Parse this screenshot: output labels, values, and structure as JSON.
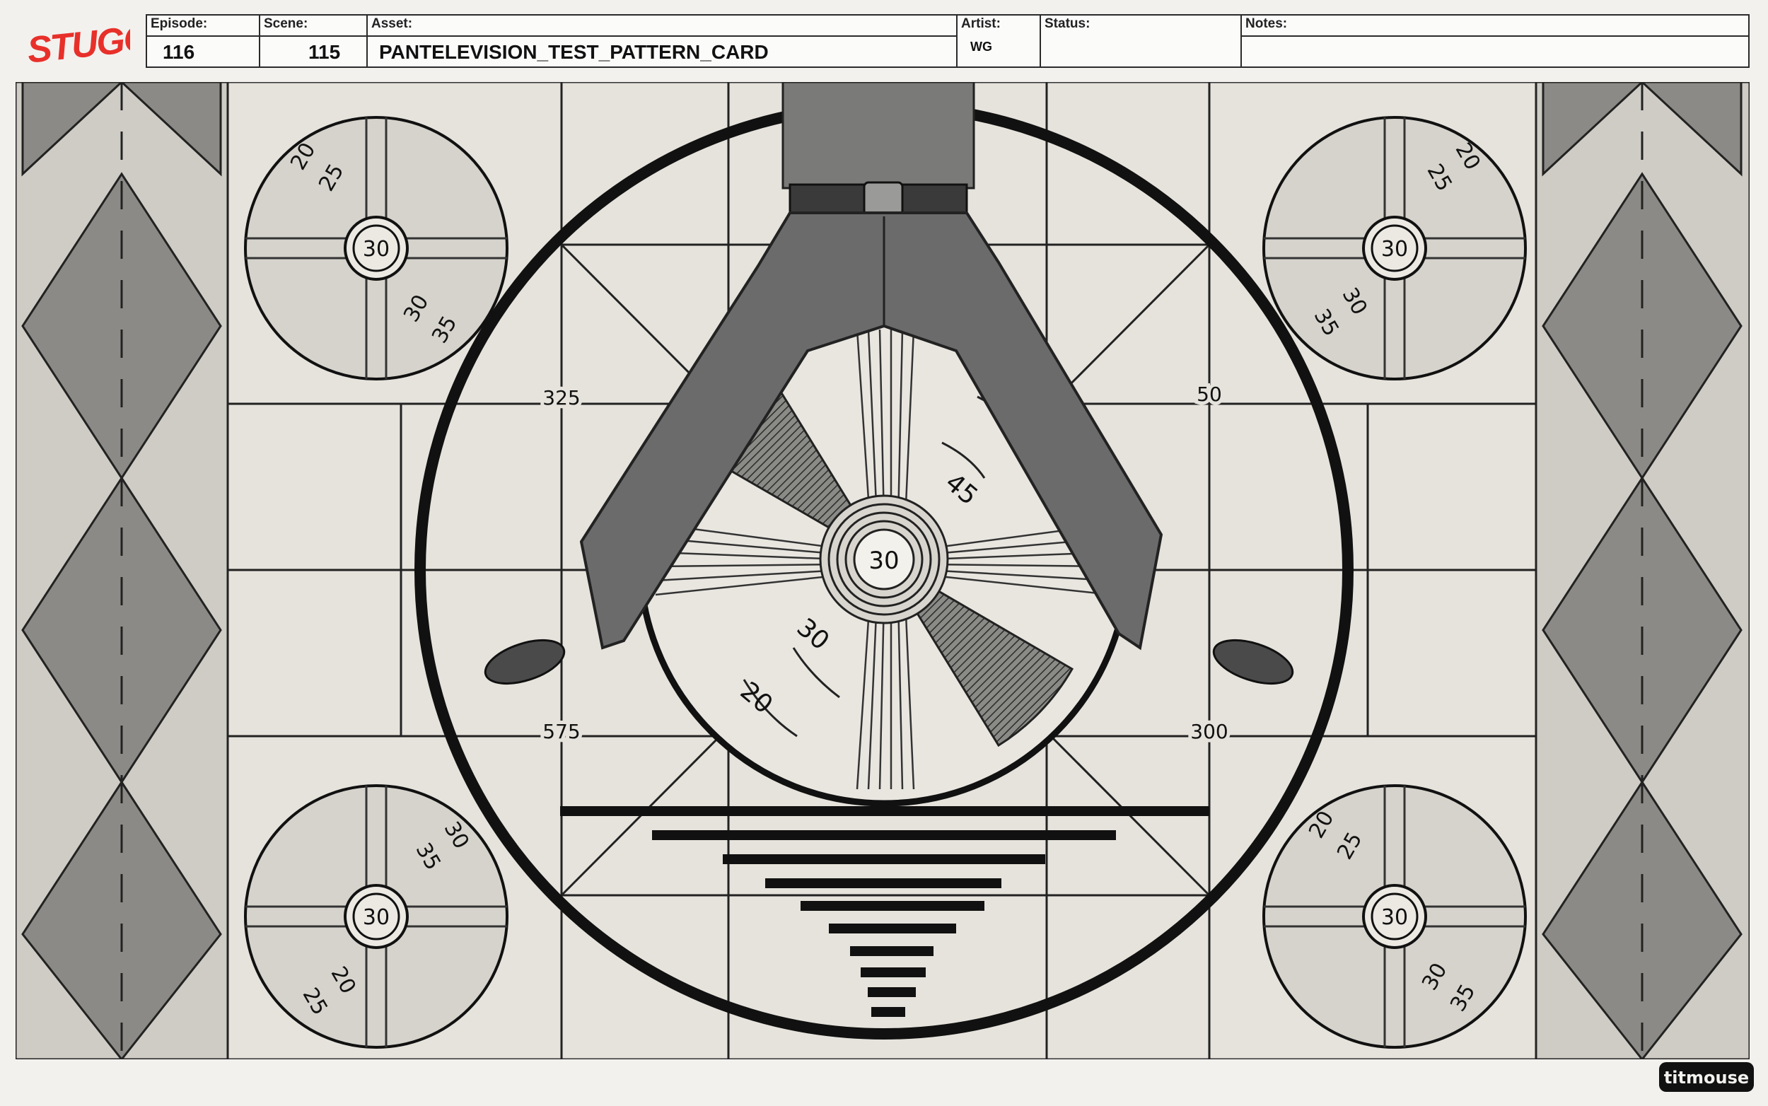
{
  "logo": {
    "text": "STUGO",
    "color": "#e8302a"
  },
  "header": {
    "episode": {
      "label": "Episode:",
      "value": "116"
    },
    "scene": {
      "label": "Scene:",
      "value": "115"
    },
    "asset": {
      "label": "Asset:",
      "value": "PANTELEVISION_TEST_PATTERN_CARD"
    },
    "artist": {
      "label": "Artist:",
      "value": "WG"
    },
    "status": {
      "label": "Status:",
      "value": ""
    },
    "notes": {
      "label": "Notes:",
      "value": ""
    }
  },
  "test_pattern": {
    "center_number": "30",
    "center_wheel_labels": [
      "35",
      "45",
      "30",
      "20"
    ],
    "ring_labels": [
      "325",
      "50",
      "575",
      "300"
    ],
    "corner_circles": [
      {
        "position": "top-left",
        "center": "30",
        "labels": [
          "20",
          "25",
          "30",
          "35"
        ]
      },
      {
        "position": "top-right",
        "center": "30",
        "labels": [
          "20",
          "25",
          "30",
          "35"
        ]
      },
      {
        "position": "bottom-left",
        "center": "30",
        "labels": [
          "30",
          "35",
          "20",
          "25"
        ]
      },
      {
        "position": "bottom-right",
        "center": "30",
        "labels": [
          "20",
          "25",
          "30",
          "35"
        ]
      }
    ]
  },
  "footer": {
    "studio_mark": "titmouse"
  },
  "colors": {
    "paper": "#e6e3dc",
    "ink": "#1e1e1e",
    "accent": "#e8302a",
    "pants": "#6b6b6b"
  }
}
